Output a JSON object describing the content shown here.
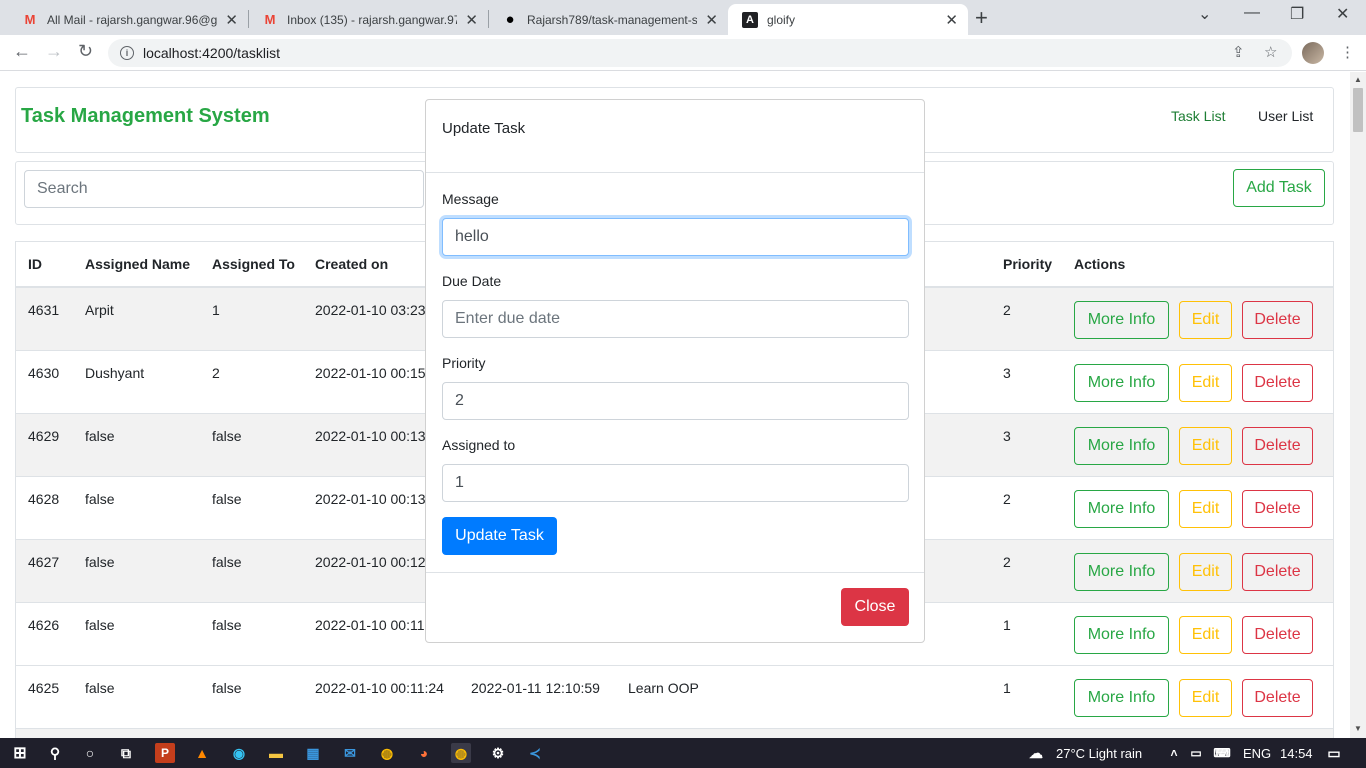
{
  "browser": {
    "tabs": [
      {
        "title": "All Mail - rajarsh.gangwar.96@gm",
        "icon": "gmail-icon"
      },
      {
        "title": "Inbox (135) - rajarsh.gangwar.97@",
        "icon": "gmail-icon"
      },
      {
        "title": "Rajarsh789/task-management-sy",
        "icon": "github-icon"
      },
      {
        "title": "gloify",
        "icon": "angular-icon"
      }
    ],
    "url": "localhost:4200/tasklist"
  },
  "app": {
    "brand": "Task Management System",
    "nav": {
      "task_list": "Task List",
      "user_list": "User List"
    },
    "search_placeholder": "Search",
    "add_task": "Add Task",
    "columns": [
      "ID",
      "Assigned Name",
      "Assigned To",
      "Created on",
      "Priority",
      "Actions"
    ],
    "actions": {
      "more_info": "More Info",
      "edit": "Edit",
      "delete": "Delete"
    },
    "rows": [
      {
        "id": "4631",
        "name": "Arpit",
        "to": "1",
        "created": "2022-01-10 03:23:",
        "due": "",
        "message": "",
        "priority": "2"
      },
      {
        "id": "4630",
        "name": "Dushyant",
        "to": "2",
        "created": "2022-01-10 00:15:",
        "due": "",
        "message": "",
        "priority": "3"
      },
      {
        "id": "4629",
        "name": "false",
        "to": "false",
        "created": "2022-01-10 00:13:",
        "due": "",
        "message": "",
        "priority": "3"
      },
      {
        "id": "4628",
        "name": "false",
        "to": "false",
        "created": "2022-01-10 00:13:",
        "due": "",
        "message": "",
        "priority": "2"
      },
      {
        "id": "4627",
        "name": "false",
        "to": "false",
        "created": "2022-01-10 00:12:",
        "due": "",
        "message": "",
        "priority": "2"
      },
      {
        "id": "4626",
        "name": "false",
        "to": "false",
        "created": "2022-01-10 00:11:",
        "due": "",
        "message": "",
        "priority": "1"
      },
      {
        "id": "4625",
        "name": "false",
        "to": "false",
        "created": "2022-01-10 00:11:24",
        "due": "2022-01-11 12:10:59",
        "message": "Learn OOP",
        "priority": "1"
      }
    ]
  },
  "modal": {
    "title": "Update Task",
    "message_label": "Message",
    "message_value": "hello",
    "due_label": "Due Date",
    "due_placeholder": "Enter due date",
    "priority_label": "Priority",
    "priority_value": "2",
    "assigned_label": "Assigned to",
    "assigned_value": "1",
    "submit": "Update Task",
    "close": "Close"
  },
  "taskbar": {
    "weather": "27°C  Light rain",
    "lang": "ENG",
    "time": "14:54"
  },
  "colors": {
    "success": "#28a745",
    "warning": "#ffc107",
    "danger": "#dc3545",
    "primary": "#007bff"
  }
}
